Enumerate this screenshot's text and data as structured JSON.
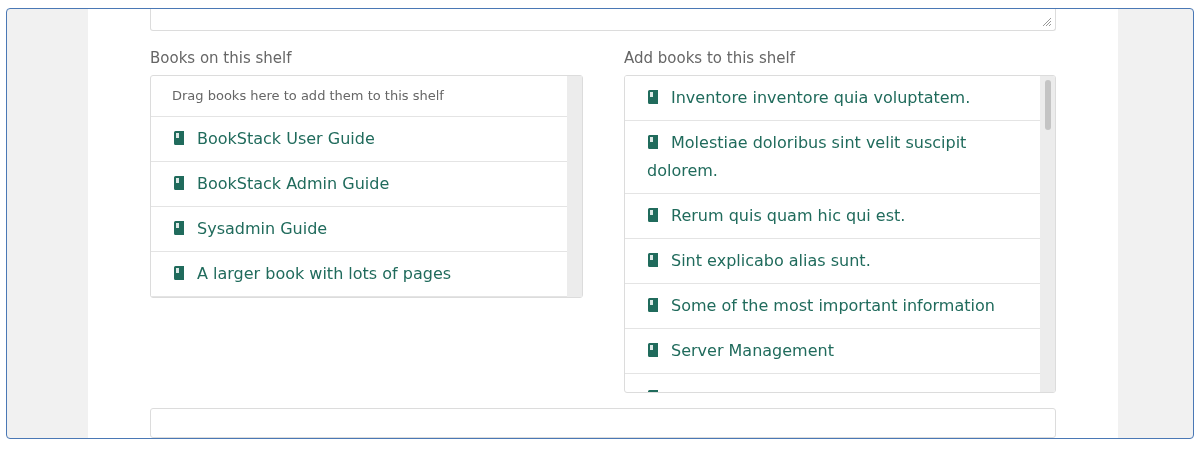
{
  "shelf_books": {
    "label": "Books on this shelf",
    "hint": "Drag books here to add them to this shelf",
    "books": [
      {
        "title": "BookStack User Guide"
      },
      {
        "title": "BookStack Admin Guide"
      },
      {
        "title": "Sysadmin Guide"
      },
      {
        "title": "A larger book with lots of pages"
      }
    ]
  },
  "add_books": {
    "label": "Add books to this shelf",
    "books": [
      {
        "title": "Inventore inventore quia voluptatem."
      },
      {
        "title": "Molestiae doloribus sint velit suscipit dolorem."
      },
      {
        "title": "Rerum quis quam hic qui est."
      },
      {
        "title": "Sint explicabo alias sunt."
      },
      {
        "title": "Some of the most important information"
      },
      {
        "title": "Server Management"
      }
    ]
  }
}
